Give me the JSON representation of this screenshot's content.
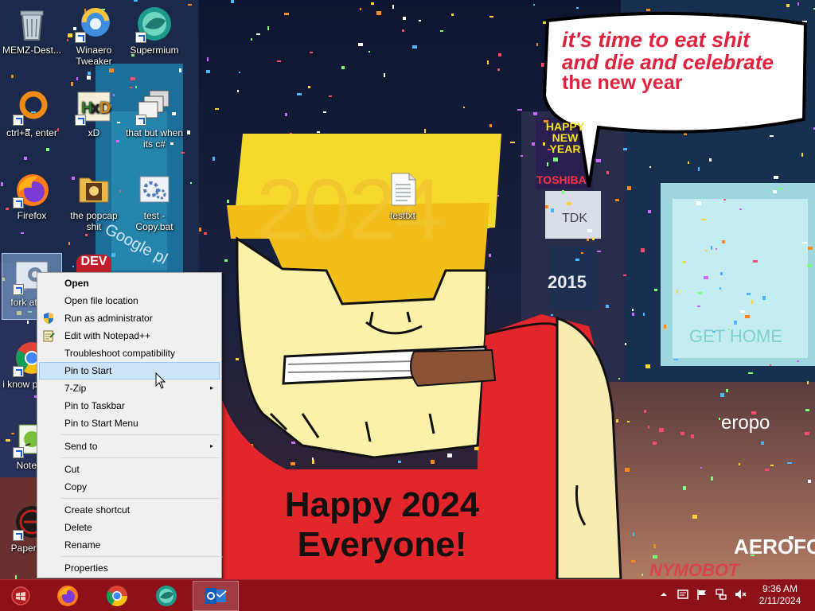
{
  "wallpaper": {
    "bubble_lines": [
      "it's time to eat shit",
      "and die and celebrate",
      "the new year"
    ],
    "poster_year": "2024",
    "poster_lines": [
      "Happy 2024",
      "Everyone!"
    ],
    "signs": {
      "happy_new_year": [
        "HAPPY",
        "NEW",
        "YEAR"
      ],
      "toshiba": "TOSHIBA",
      "tdk": "TDK",
      "year_2015": "2015",
      "get_home": "GET HOME",
      "aeropostale": "eropo",
      "aerofos": "AEROFOS",
      "google": "Google pl",
      "dev": "DEV",
      "watermark": "NYMOBOT"
    }
  },
  "desktop_icons": [
    {
      "label": "MEMZ-Dest...",
      "icon": "recycle-bin-icon"
    },
    {
      "label": "Winaero Tweaker",
      "icon": "winaero-tweaker-icon"
    },
    {
      "label": "Supermium",
      "icon": "supermium-icon"
    },
    {
      "label": "ctrl+a, enter",
      "icon": "orange-ring-icon"
    },
    {
      "label": "xD",
      "icon": "hxd-icon"
    },
    {
      "label": "that but when its c#",
      "icon": "windows-stack-icon"
    },
    {
      "label": "Firefox",
      "icon": "firefox-icon"
    },
    {
      "label": "the popcap shit",
      "icon": "popcap-folder-icon"
    },
    {
      "label": "test - Copy.bat",
      "icon": "batch-file-icon"
    },
    {
      "label": "testtxt",
      "icon": "text-file-icon"
    },
    {
      "label": "fork attrac",
      "icon": "gear-exe-icon"
    },
    {
      "label": "i know people",
      "icon": "chrome-icon"
    },
    {
      "label": "Notepa",
      "icon": "notepad-plus-icon"
    },
    {
      "label": "Papers, P",
      "icon": "papers-please-icon"
    }
  ],
  "context_menu": {
    "items": [
      {
        "label": "Open",
        "bold": true
      },
      {
        "label": "Open file location"
      },
      {
        "label": "Run as administrator",
        "icon": "uac-shield-icon"
      },
      {
        "label": "Edit with Notepad++",
        "icon": "notepad-plus-icon"
      },
      {
        "label": "Troubleshoot compatibility"
      },
      {
        "label": "Pin to Start",
        "hover": true
      },
      {
        "label": "7-Zip",
        "submenu": true
      },
      {
        "label": "Pin to Taskbar"
      },
      {
        "label": "Pin to Start Menu"
      },
      {
        "label": "Send to",
        "submenu": true
      },
      {
        "label": "Cut"
      },
      {
        "label": "Copy"
      },
      {
        "label": "Create shortcut"
      },
      {
        "label": "Delete"
      },
      {
        "label": "Rename"
      },
      {
        "label": "Properties"
      }
    ],
    "submenu_arrow": "▸"
  },
  "taskbar": {
    "start_icon": "start-orb-icon",
    "pinned": [
      {
        "name": "firefox",
        "icon": "firefox-icon"
      },
      {
        "name": "chrome",
        "icon": "chrome-icon"
      },
      {
        "name": "supermium",
        "icon": "supermium-icon"
      },
      {
        "name": "outlook",
        "icon": "outlook-icon",
        "active": true
      }
    ],
    "tray": [
      "show-hidden-icons-chevron",
      "action-center-icon",
      "flag-icon",
      "network-icon",
      "volume-muted-icon"
    ],
    "time": "9:36 AM",
    "date": "2/11/2024"
  },
  "colors": {
    "taskbar": "#8c1119",
    "menu_background": "#f0f0f0",
    "menu_hover": "#cce4f7",
    "bubble_text": "#e0223f",
    "poster_red": "#e2262b",
    "poster_yellow": "#f5d92c"
  }
}
